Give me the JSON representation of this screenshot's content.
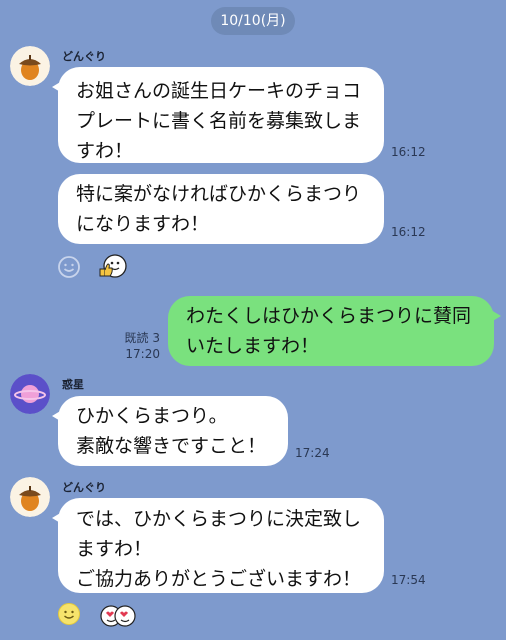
{
  "date_label": "10/10(月)",
  "messages": [
    {
      "sender": "どんぐり",
      "text": "お姐さんの誕生日ケーキのチョコ\nプレートに書く名前を募集致しま\nすわ！",
      "time": "16:12"
    },
    {
      "text": "特に案がなければひかくらまつり\nになりますわ！",
      "time": "16:12",
      "reactions": [
        "smile-outline-icon",
        "thumbs-up-icon"
      ]
    },
    {
      "mine": true,
      "text": "わたくしはひかくらまつりに賛同\nいたしますわ！",
      "read": "既読 3",
      "time": "17:20"
    },
    {
      "sender": "惑星",
      "text": "ひかくらまつり。\n素敵な響きですこと！",
      "time": "17:24"
    },
    {
      "sender": "どんぐり",
      "text": "では、ひかくらまつりに決定致し\nますわ！\nご協力ありがとうございますわ！",
      "time": "17:54",
      "reactions": [
        "smile-icon",
        "heart-eyes-icon"
      ]
    }
  ],
  "colors": {
    "background": "#7e9acd",
    "bubble_other": "#ffffff",
    "bubble_mine": "#7ae17e",
    "date_pill": "#6f8ab7"
  }
}
